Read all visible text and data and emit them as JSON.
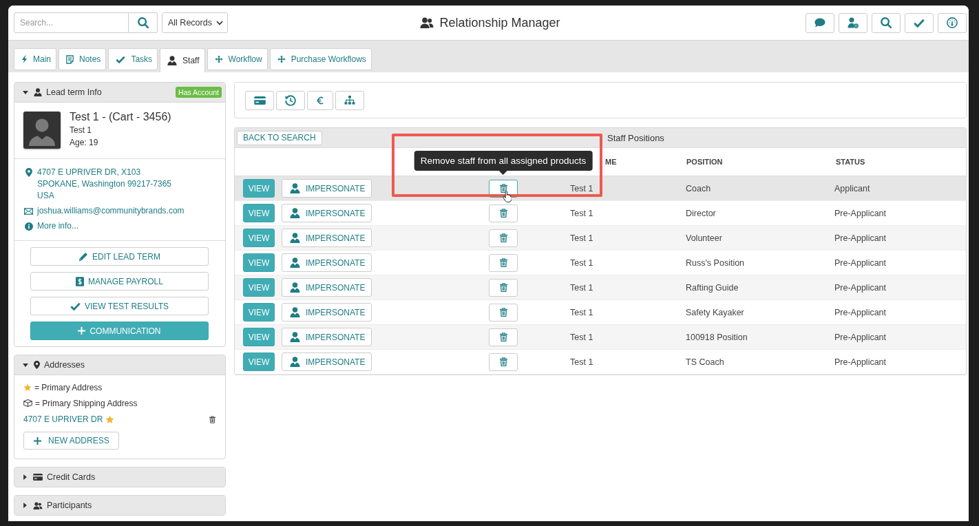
{
  "header": {
    "search": {
      "placeholder": "Search..."
    },
    "record_filter": {
      "value": "All Records"
    },
    "title": "Relationship Manager"
  },
  "tabs": [
    {
      "label": "Main",
      "selected": false
    },
    {
      "label": "Notes",
      "selected": false
    },
    {
      "label": "Tasks",
      "selected": false
    },
    {
      "label": "Staff",
      "selected": true
    },
    {
      "label": "Workflow",
      "selected": false
    },
    {
      "label": "Purchase Workflows",
      "selected": false
    }
  ],
  "sidebar": {
    "panels": [
      {
        "kind": "lead",
        "title": "Lead term Info",
        "expanded": true,
        "badge": "Has Account",
        "profile": {
          "name": "Test 1 - (Cart - 3456)",
          "subtitle": "Test 1",
          "age": "Age: 19"
        },
        "address_lines": [
          "4707 E UPRIVER DR, X103",
          "SPOKANE, Washington 99217-7365",
          "USA"
        ],
        "email": "joshua.williams@communitybrands.com",
        "more_link": "More info...",
        "buttons": [
          {
            "kind": "edit",
            "label": "EDIT LEAD TERM"
          },
          {
            "kind": "payroll",
            "label": "MANAGE PAYROLL"
          },
          {
            "kind": "results",
            "label": "VIEW TEST RESULTS"
          },
          {
            "kind": "primary",
            "label": "COMMUNICATION"
          }
        ]
      },
      {
        "kind": "addresses",
        "title": "Addresses",
        "expanded": true,
        "legend": [
          {
            "kind": "star",
            "text": "= Primary Address"
          },
          {
            "kind": "box",
            "text": "= Primary Shipping Address"
          }
        ],
        "addresses": [
          {
            "label": "4707 E UPRIVER DR",
            "primary": true
          }
        ],
        "new_button": "NEW ADDRESS"
      },
      {
        "kind": "cards",
        "title": "Credit Cards",
        "expanded": false
      },
      {
        "kind": "participants",
        "title": "Participants",
        "expanded": false
      }
    ]
  },
  "staff_table": {
    "back_button": "BACK TO SEARCH",
    "title": "Staff Positions",
    "column_headers": [
      "ME",
      "POSITION",
      "STATUS"
    ],
    "rows": [
      {
        "view": "VIEW",
        "impersonate": "IMPERSONATE",
        "name": "Test 1",
        "position": "Coach",
        "status": "Applicant",
        "hovered": true
      },
      {
        "view": "VIEW",
        "impersonate": "IMPERSONATE",
        "name": "Test 1",
        "position": "Director",
        "status": "Pre-Applicant",
        "hovered": false
      },
      {
        "view": "VIEW",
        "impersonate": "IMPERSONATE",
        "name": "Test 1",
        "position": "Volunteer",
        "status": "Pre-Applicant",
        "hovered": false
      },
      {
        "view": "VIEW",
        "impersonate": "IMPERSONATE",
        "name": "Test 1",
        "position": "Russ's Position",
        "status": "Pre-Applicant",
        "hovered": false
      },
      {
        "view": "VIEW",
        "impersonate": "IMPERSONATE",
        "name": "Test 1",
        "position": "Rafting Guide",
        "status": "Pre-Applicant",
        "hovered": false
      },
      {
        "view": "VIEW",
        "impersonate": "IMPERSONATE",
        "name": "Test 1",
        "position": "Safety Kayaker",
        "status": "Pre-Applicant",
        "hovered": false
      },
      {
        "view": "VIEW",
        "impersonate": "IMPERSONATE",
        "name": "Test 1",
        "position": "100918 Position",
        "status": "Pre-Applicant",
        "hovered": false
      },
      {
        "view": "VIEW",
        "impersonate": "IMPERSONATE",
        "name": "Test 1",
        "position": "TS Coach",
        "status": "Pre-Applicant",
        "hovered": false
      }
    ],
    "tooltip": "Remove staff from all assigned products"
  }
}
